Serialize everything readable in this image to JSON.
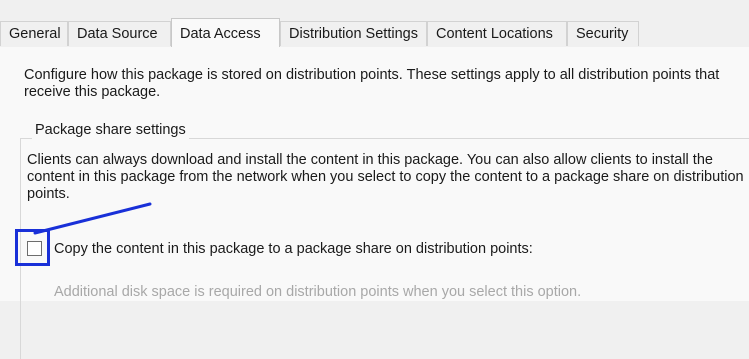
{
  "tabs": [
    {
      "label": "General"
    },
    {
      "label": "Data Source"
    },
    {
      "label": "Data Access",
      "active": true
    },
    {
      "label": "Distribution Settings"
    },
    {
      "label": "Content Locations"
    },
    {
      "label": "Security"
    }
  ],
  "data_access": {
    "description": "Configure how this package is stored on distribution points. These settings apply to all distribution points that receive this package.",
    "group_title": "Package share settings",
    "group_description": "Clients can always download and install the content in this package. You can also allow clients to install the content in this package from the network when you select to copy the content to a package share on distribution points.",
    "copy_checkbox": {
      "label": "Copy the content in this package to a package share on distribution points:",
      "checked": false
    },
    "disk_space_note": "Additional disk space is required on distribution points when you select this option."
  },
  "annotation": {
    "color": "#1930d8",
    "shape": "highlight-box-with-arrow"
  }
}
